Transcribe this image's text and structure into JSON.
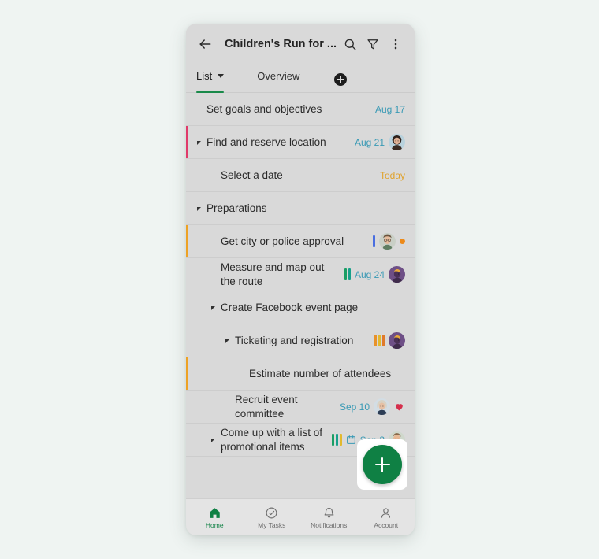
{
  "app": {
    "title": "Children's Run for ...",
    "back_icon": "arrow-left-icon",
    "search_icon": "search-icon",
    "filter_icon": "filter-icon",
    "more_icon": "more-vertical-icon"
  },
  "tabs": {
    "list_label": "List",
    "overview_label": "Overview",
    "add_tab_icon": "plus-circle-icon",
    "active": "List",
    "underline_color": "#1a8a4a"
  },
  "colors": {
    "page_background": "#eff4f2",
    "phone_background": "#d9d9d9",
    "accent_green": "#0f8044",
    "due_blue": "#3a9ab5",
    "due_today_amber": "#e0a22c",
    "accent_pink": "#e03a6a",
    "accent_orange": "#eda224"
  },
  "tasks": [
    {
      "title": "Set goals and objectives",
      "level": 0,
      "expandable": false,
      "due": "Aug 17",
      "due_style": "blue",
      "accent": null,
      "tags": [],
      "avatar": null,
      "dot": false,
      "heart": false,
      "calendar": false
    },
    {
      "title": "Find and reserve location",
      "level": 0,
      "expandable": true,
      "due": "Aug 21",
      "due_style": "blue",
      "accent": "#e03a6a",
      "tags": [],
      "avatar": "woman-dark-hair",
      "dot": false,
      "heart": false,
      "calendar": false
    },
    {
      "title": "Select a date",
      "level": 1,
      "expandable": false,
      "due": "Today",
      "due_style": "today",
      "accent": null,
      "tags": [],
      "avatar": null,
      "dot": false,
      "heart": false,
      "calendar": false
    },
    {
      "title": "Preparations",
      "level": 0,
      "expandable": true,
      "due": null,
      "due_style": null,
      "accent": null,
      "tags": [],
      "avatar": null,
      "dot": false,
      "heart": false,
      "calendar": false
    },
    {
      "title": "Get city or police approval",
      "level": 1,
      "expandable": false,
      "due": null,
      "due_style": null,
      "accent": "#eda224",
      "tags": [
        "#4a6ee0"
      ],
      "avatar": "man-glasses",
      "dot": true,
      "heart": false,
      "calendar": false
    },
    {
      "title": "Measure and map out the route",
      "level": 1,
      "expandable": false,
      "due": "Aug 24",
      "due_style": "blue",
      "accent": null,
      "tags": [
        "#1a9e64",
        "#17a08a"
      ],
      "avatar": "person-purple",
      "dot": false,
      "heart": false,
      "calendar": false
    },
    {
      "title": "Create Facebook event page",
      "level": 1,
      "expandable": true,
      "due": null,
      "due_style": null,
      "accent": null,
      "tags": [],
      "avatar": null,
      "dot": false,
      "heart": false,
      "calendar": false
    },
    {
      "title": "Ticketing and registration",
      "level": 2,
      "expandable": true,
      "due": null,
      "due_style": null,
      "accent": null,
      "tags": [
        "#e8922a",
        "#e2b92e",
        "#e07a2a"
      ],
      "avatar": "person-purple",
      "dot": false,
      "heart": false,
      "calendar": false
    },
    {
      "title": "Estimate number of attendees",
      "level": 3,
      "expandable": false,
      "due": null,
      "due_style": null,
      "accent": "#eda224",
      "tags": [],
      "avatar": null,
      "dot": false,
      "heart": false,
      "calendar": false
    },
    {
      "title": "Recruit event committee",
      "level": 2,
      "expandable": false,
      "due": "Sep 10",
      "due_style": "blue",
      "accent": null,
      "tags": [],
      "avatar": "woman-blonde",
      "dot": false,
      "heart": true,
      "calendar": false
    },
    {
      "title": "Come up with a list of promotional items",
      "level": 1,
      "expandable": true,
      "due": "Sep 3",
      "due_style": "blue",
      "accent": null,
      "tags": [
        "#1a9e64",
        "#17a08a",
        "#e2b92e"
      ],
      "avatar": "man-smiling",
      "dot": false,
      "heart": false,
      "calendar": true
    }
  ],
  "fab": {
    "icon": "plus-icon",
    "color": "#0f8044"
  },
  "bottom_nav": [
    {
      "label": "Home",
      "icon": "home-icon",
      "active": true
    },
    {
      "label": "My Tasks",
      "icon": "check-circle-icon",
      "active": false
    },
    {
      "label": "Notifications",
      "icon": "bell-icon",
      "active": false
    },
    {
      "label": "Account",
      "icon": "person-icon",
      "active": false
    }
  ]
}
